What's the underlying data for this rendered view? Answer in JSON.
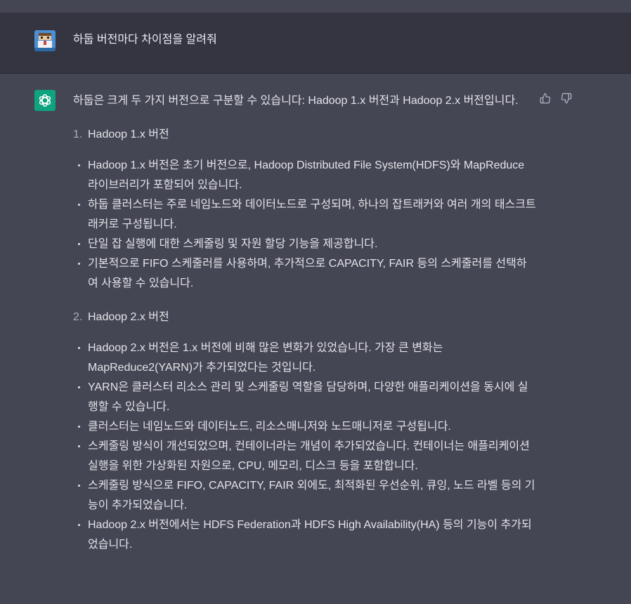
{
  "user_message": "하둡 버전마다 차이점을 알려줘",
  "assistant": {
    "intro": "하둡은 크게 두 가지 버전으로 구분할 수 있습니다: Hadoop 1.x 버전과 Hadoop 2.x 버전입니다.",
    "sections": [
      {
        "number": "1.",
        "title": "Hadoop 1.x 버전",
        "bullets": [
          "Hadoop 1.x 버전은 초기 버전으로, Hadoop Distributed File System(HDFS)와 MapReduce 라이브러리가 포함되어 있습니다.",
          "하둡 클러스터는 주로 네임노드와 데이터노드로 구성되며, 하나의 잡트래커와 여러 개의 태스크트래커로 구성됩니다.",
          "단일 잡 실행에 대한 스케줄링 및 자원 할당 기능을 제공합니다.",
          "기본적으로 FIFO 스케줄러를 사용하며, 추가적으로 CAPACITY, FAIR 등의 스케줄러를 선택하여 사용할 수 있습니다."
        ]
      },
      {
        "number": "2.",
        "title": "Hadoop 2.x 버전",
        "bullets": [
          "Hadoop 2.x 버전은 1.x 버전에 비해 많은 변화가 있었습니다. 가장 큰 변화는 MapReduce2(YARN)가 추가되었다는 것입니다.",
          "YARN은 클러스터 리소스 관리 및 스케줄링 역할을 담당하며, 다양한 애플리케이션을 동시에 실행할 수 있습니다.",
          "클러스터는 네임노드와 데이터노드, 리소스매니저와 노드매니저로 구성됩니다.",
          "스케줄링 방식이 개선되었으며, 컨테이너라는 개념이 추가되었습니다. 컨테이너는 애플리케이션 실행을 위한 가상화된 자원으로, CPU, 메모리, 디스크 등을 포함합니다.",
          "스케줄링 방식으로 FIFO, CAPACITY, FAIR 외에도, 최적화된 우선순위, 큐잉, 노드 라벨 등의 기능이 추가되었습니다.",
          "Hadoop 2.x 버전에서는 HDFS Federation과 HDFS High Availability(HA) 등의 기능이 추가되었습니다."
        ]
      }
    ]
  },
  "icons": {
    "user_avatar": "user-avatar",
    "assistant_avatar": "openai-logo-icon",
    "thumbs_up": "thumbs-up-icon",
    "thumbs_down": "thumbs-down-icon"
  },
  "colors": {
    "user_bg": "#343541",
    "assistant_bg": "#444654",
    "gpt_avatar": "#10a37f",
    "text": "#ececf1"
  }
}
